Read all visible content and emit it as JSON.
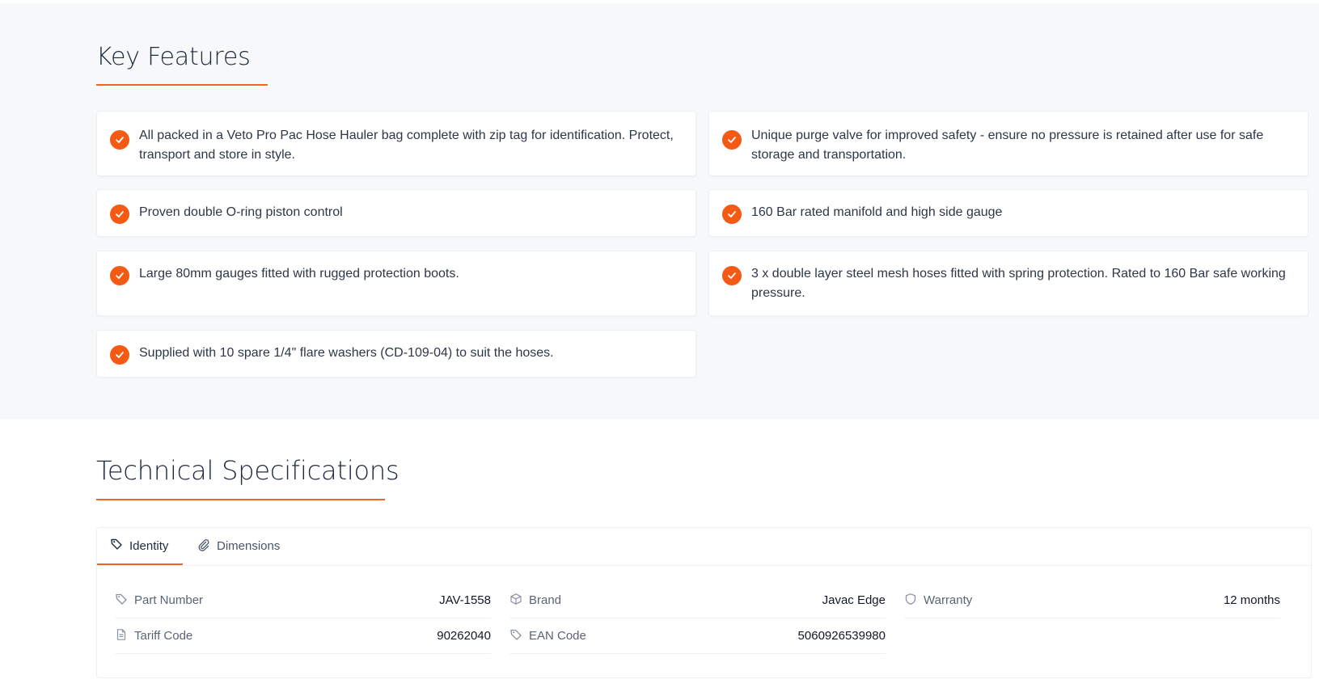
{
  "key_features": {
    "title": "Key Features",
    "items": [
      {
        "text": "All packed in a Veto Pro Pac Hose Hauler bag complete with zip tag for identification. Protect, transport and store in style."
      },
      {
        "text": "Unique purge valve for improved safety - ensure no pressure is retained after use for safe storage and transportation."
      },
      {
        "text": "Proven double O-ring piston control"
      },
      {
        "text": "160 Bar rated manifold and high side gauge"
      },
      {
        "text": "Large 80mm gauges fitted with rugged protection boots."
      },
      {
        "text": "3 x double layer steel mesh hoses fitted with spring protection. Rated to 160 Bar safe working pressure."
      },
      {
        "text": "Supplied with 10 spare 1/4\" flare washers (CD-109-04) to suit the hoses."
      }
    ]
  },
  "technical_specifications": {
    "title": "Technical Specifications",
    "tabs": [
      {
        "label": "Identity",
        "icon": "tag-icon",
        "active": true
      },
      {
        "label": "Dimensions",
        "icon": "paperclip-icon",
        "active": false
      }
    ],
    "rows": [
      {
        "label": "Part Number",
        "value": "JAV-1558",
        "icon": "tag-icon"
      },
      {
        "label": "Brand",
        "value": "Javac Edge",
        "icon": "box-icon"
      },
      {
        "label": "Warranty",
        "value": "12 months",
        "icon": "shield-icon"
      },
      {
        "label": "Tariff Code",
        "value": "90262040",
        "icon": "document-icon"
      },
      {
        "label": "EAN Code",
        "value": "5060926539980",
        "icon": "tag-icon"
      }
    ]
  },
  "colors": {
    "accent": "#f26522",
    "check_fill": "#f45a14",
    "section_background": "#f7f8fa"
  }
}
